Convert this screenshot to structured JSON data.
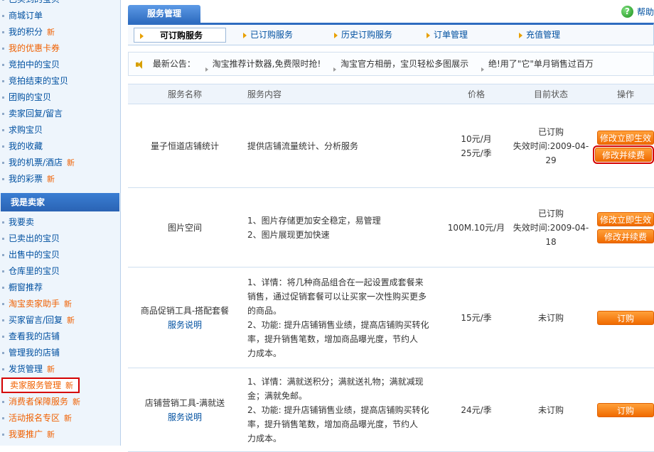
{
  "sidebar": {
    "buyer_items": [
      {
        "label": "已买到的宝贝",
        "new": ""
      },
      {
        "label": "商城订单",
        "new": ""
      },
      {
        "label": "我的积分",
        "new": "新"
      },
      {
        "label": "我的优惠卡券",
        "new": "",
        "orange": true
      },
      {
        "label": "竞拍中的宝贝",
        "new": ""
      },
      {
        "label": "竞拍结束的宝贝",
        "new": ""
      },
      {
        "label": "团购的宝贝",
        "new": ""
      },
      {
        "label": "卖家回复/留言",
        "new": ""
      },
      {
        "label": "求购宝贝",
        "new": ""
      },
      {
        "label": "我的收藏",
        "new": ""
      },
      {
        "label": "我的机票/酒店",
        "new": "新"
      },
      {
        "label": "我的彩票",
        "new": "新"
      }
    ],
    "seller_title": "我是卖家",
    "seller_items": [
      {
        "label": "我要卖",
        "new": ""
      },
      {
        "label": "已卖出的宝贝",
        "new": ""
      },
      {
        "label": "出售中的宝贝",
        "new": ""
      },
      {
        "label": "仓库里的宝贝",
        "new": ""
      },
      {
        "label": "橱窗推荐",
        "new": ""
      },
      {
        "label": "淘宝卖家助手",
        "new": "新",
        "orange": true
      },
      {
        "label": "买家留言/回复",
        "new": "新"
      },
      {
        "label": "查看我的店铺",
        "new": ""
      },
      {
        "label": "管理我的店铺",
        "new": ""
      },
      {
        "label": "发货管理",
        "new": "新"
      },
      {
        "label": "卖家服务管理",
        "new": "新",
        "orange": true,
        "active": true
      },
      {
        "label": "消费者保障服务",
        "new": "新",
        "orange": true
      },
      {
        "label": "活动报名专区",
        "new": "新",
        "orange": true
      },
      {
        "label": "我要推广",
        "new": "新",
        "orange": true
      }
    ]
  },
  "header": {
    "title": "服务管理",
    "help": "帮助"
  },
  "nav": {
    "tabs": [
      "可订购服务",
      "已订购服务",
      "历史订购服务",
      "订单管理",
      "充值管理"
    ]
  },
  "notice": {
    "label": "最新公告：",
    "items": [
      "淘宝推荐计数器,免费限时抢!",
      "淘宝官方相册，宝贝轻松多图展示",
      "绝!用了\"它\"单月销售过百万"
    ]
  },
  "table": {
    "headers": [
      "服务名称",
      "服务内容",
      "价格",
      "目前状态",
      "操作"
    ],
    "rows": [
      {
        "name": "量子恒道店铺统计",
        "link": "",
        "content": [
          "提供店铺流量统计、分析服务"
        ],
        "price": [
          "10元/月",
          "25元/季"
        ],
        "status": [
          "已订购",
          "失效时间:2009-04-",
          "29"
        ],
        "actions": [
          "修改立即生效",
          "修改并续费"
        ]
      },
      {
        "name": "图片空间",
        "link": "",
        "content": [
          "1、图片存储更加安全稳定，易管理",
          "2、图片展现更加快速"
        ],
        "price": [
          "100M.10元/月"
        ],
        "status": [
          "已订购",
          "失效时间:2009-04-",
          "18"
        ],
        "actions": [
          "修改立即生效",
          "修改并续费"
        ]
      },
      {
        "name": "商品促销工具-搭配套餐",
        "link": "服务说明",
        "content": [
          "1、详情：将几种商品组合在一起设置成套餐来",
          "销售，通过促销套餐可以让买家一次性购买更多",
          "的商品。",
          "2、功能: 提升店铺销售业绩，提高店铺购买转化",
          "率，提升销售笔数，增加商品曝光度，节约人",
          "力成本。"
        ],
        "price": [
          "15元/季"
        ],
        "status": [
          "未订购"
        ],
        "actions": [
          "订购"
        ]
      },
      {
        "name": "店铺营销工具-满就送",
        "link": "服务说明",
        "content": [
          "1、详情：满就送积分；满就送礼物；满就减现",
          "金；满就免邮。",
          "2、功能: 提升店铺销售业绩，提高店铺购买转化",
          "率，提升销售笔数，增加商品曝光度，节约人",
          "力成本。"
        ],
        "price": [
          "24元/季"
        ],
        "status": [
          "未订购"
        ],
        "actions": [
          "订购"
        ]
      }
    ]
  }
}
